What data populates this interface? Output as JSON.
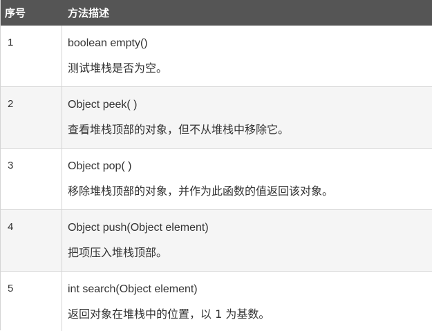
{
  "header": {
    "col_num": "序号",
    "col_desc": "方法描述"
  },
  "rows": [
    {
      "num": "1",
      "method": "boolean empty()",
      "desc": "测试堆栈是否为空。"
    },
    {
      "num": "2",
      "method": "Object peek( )",
      "desc": "查看堆栈顶部的对象，但不从堆栈中移除它。"
    },
    {
      "num": "3",
      "method": "Object pop( )",
      "desc": "移除堆栈顶部的对象，并作为此函数的值返回该对象。"
    },
    {
      "num": "4",
      "method": "Object push(Object element)",
      "desc": "把项压入堆栈顶部。"
    },
    {
      "num": "5",
      "method": "int search(Object element)",
      "desc": "返回对象在堆栈中的位置，以 1 为基数。"
    }
  ],
  "colors": {
    "header_bg": "#555555",
    "header_text": "#ffffff",
    "row_alt_bg": "#f5f5f5",
    "border": "#d4d4d4",
    "text": "#333333"
  }
}
